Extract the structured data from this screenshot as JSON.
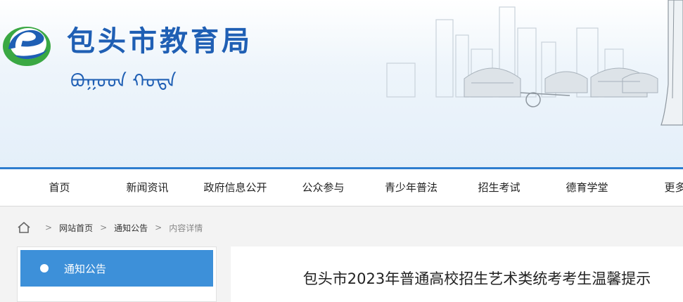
{
  "header": {
    "site_title": "包头市教育局",
    "mongol_text": "ᠪᠣᠭᠣᠳ ᠬᠣᠲᠠ",
    "colors": {
      "brand_blue": "#1f5fb4",
      "logo_green": "#3aa843",
      "nav_accent": "#2e7dcf"
    }
  },
  "nav": {
    "items": [
      {
        "label": "首页"
      },
      {
        "label": "新闻资讯"
      },
      {
        "label": "政府信息公开"
      },
      {
        "label": "公众参与"
      },
      {
        "label": "青少年普法"
      },
      {
        "label": "招生考试"
      },
      {
        "label": "德育学堂"
      },
      {
        "label": "更多"
      }
    ]
  },
  "breadcrumb": {
    "home_icon": "home-icon",
    "items": [
      {
        "label": "网站首页"
      },
      {
        "label": "通知公告"
      },
      {
        "label": "内容详情"
      }
    ],
    "separator": ">"
  },
  "sidebar": {
    "active_item": {
      "label": "通知公告",
      "color": "#3d90d9"
    }
  },
  "article": {
    "title": "包头市2023年普通高校招生艺术类统考考生温馨提示"
  }
}
